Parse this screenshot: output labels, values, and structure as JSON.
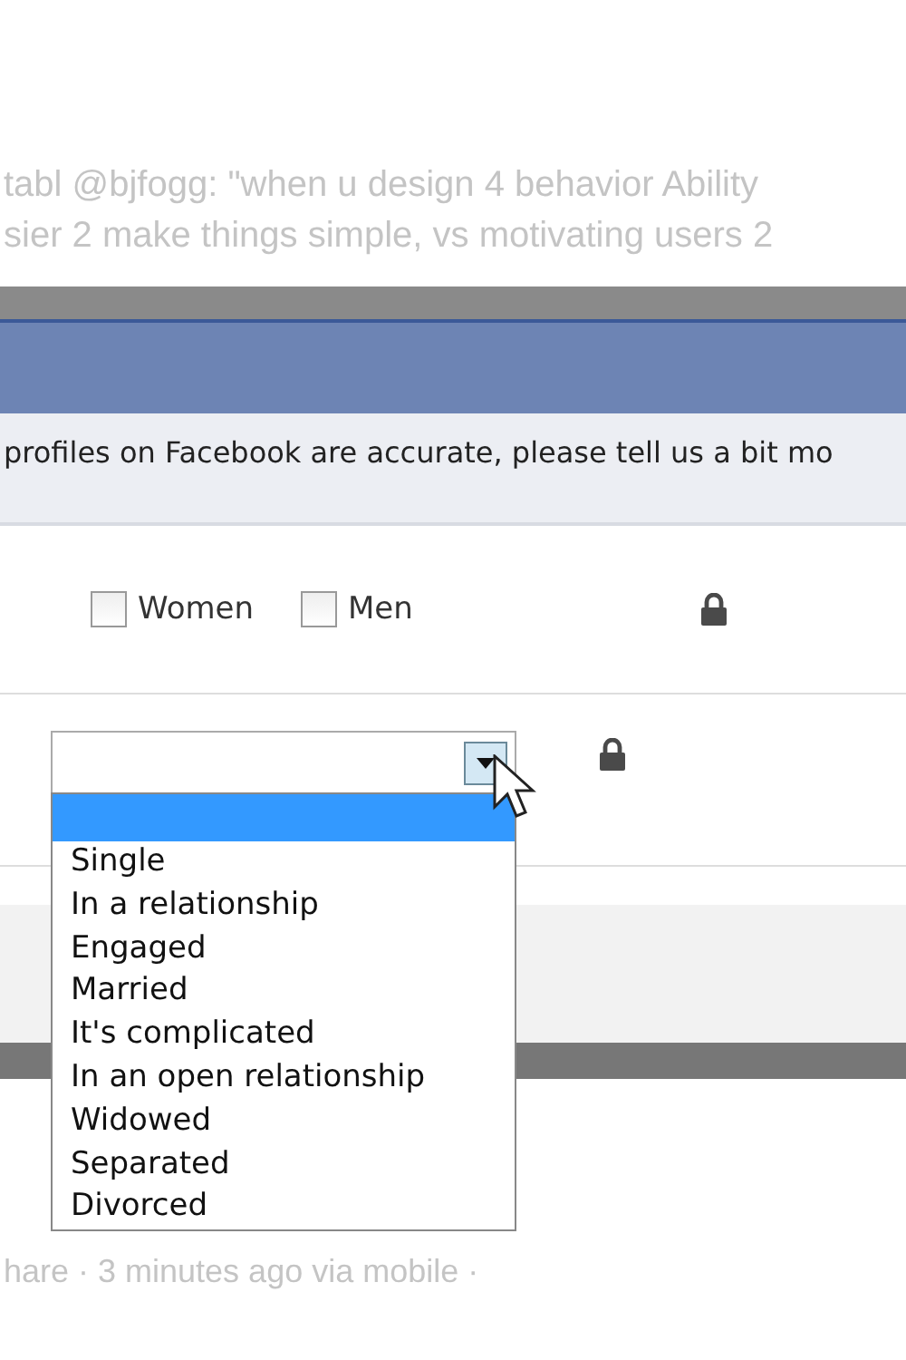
{
  "background_feed": {
    "lines": [
      "tabl @bjfogg: \"when u design 4 behavior Ability",
      "sier 2 make things simple, vs motivating users 2"
    ],
    "footer_line": "hare · 3 minutes ago via mobile ·"
  },
  "dialog": {
    "intro": "profiles on Facebook are accurate, please tell us a bit mo",
    "interested_in": [
      {
        "label": "Women",
        "checked": false
      },
      {
        "label": "Men",
        "checked": false
      }
    ],
    "relationship_select": {
      "expanded": true,
      "blank_option": {
        "selected": true
      },
      "options": [
        {
          "label": "Single",
          "selected": false
        },
        {
          "label": "In a relationship",
          "selected": false
        },
        {
          "label": "Engaged",
          "selected": false
        },
        {
          "label": "Married",
          "selected": false
        },
        {
          "label": "It's complicated",
          "selected": false
        },
        {
          "label": "In an open relationship",
          "selected": false
        },
        {
          "label": "Widowed",
          "selected": false
        },
        {
          "label": "Separated",
          "selected": false
        },
        {
          "label": "Divorced",
          "selected": false
        }
      ]
    }
  }
}
